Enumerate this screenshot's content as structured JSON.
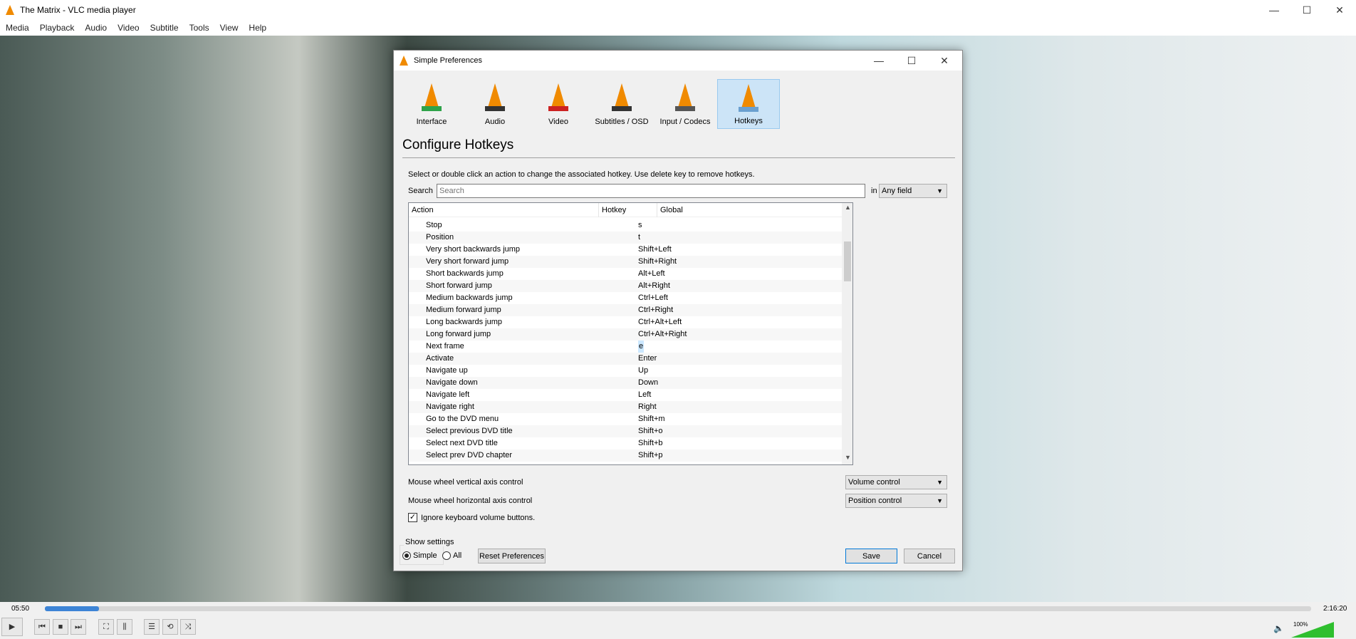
{
  "window": {
    "title": "The Matrix - VLC media player",
    "minimize": "—",
    "maximize": "☐",
    "close": "✕"
  },
  "menu": [
    "Media",
    "Playback",
    "Audio",
    "Video",
    "Subtitle",
    "Tools",
    "View",
    "Help"
  ],
  "dialog": {
    "title": "Simple Preferences",
    "tabs": [
      {
        "label": "Interface",
        "icon": "interface-icon"
      },
      {
        "label": "Audio",
        "icon": "audio-icon"
      },
      {
        "label": "Video",
        "icon": "video-icon"
      },
      {
        "label": "Subtitles / OSD",
        "icon": "subtitles-icon"
      },
      {
        "label": "Input / Codecs",
        "icon": "input-icon"
      },
      {
        "label": "Hotkeys",
        "icon": "hotkeys-icon",
        "selected": true
      }
    ],
    "heading": "Configure Hotkeys",
    "description": "Select or double click an action to change the associated hotkey. Use delete key to remove hotkeys.",
    "search_label": "Search",
    "search_placeholder": "Search",
    "in_label": "in",
    "field_select": "Any field",
    "columns": [
      "Action",
      "Hotkey",
      "Global"
    ],
    "rows": [
      {
        "action": "Stop",
        "hotkey": "s"
      },
      {
        "action": "Position",
        "hotkey": "t"
      },
      {
        "action": "Very short backwards jump",
        "hotkey": "Shift+Left"
      },
      {
        "action": "Very short forward jump",
        "hotkey": "Shift+Right"
      },
      {
        "action": "Short backwards jump",
        "hotkey": "Alt+Left"
      },
      {
        "action": "Short forward jump",
        "hotkey": "Alt+Right"
      },
      {
        "action": "Medium backwards jump",
        "hotkey": "Ctrl+Left"
      },
      {
        "action": "Medium forward jump",
        "hotkey": "Ctrl+Right"
      },
      {
        "action": "Long backwards jump",
        "hotkey": "Ctrl+Alt+Left"
      },
      {
        "action": "Long forward jump",
        "hotkey": "Ctrl+Alt+Right"
      },
      {
        "action": "Next frame",
        "hotkey": "e",
        "selected": true
      },
      {
        "action": "Activate",
        "hotkey": "Enter"
      },
      {
        "action": "Navigate up",
        "hotkey": "Up"
      },
      {
        "action": "Navigate down",
        "hotkey": "Down"
      },
      {
        "action": "Navigate left",
        "hotkey": "Left"
      },
      {
        "action": "Navigate right",
        "hotkey": "Right"
      },
      {
        "action": "Go to the DVD menu",
        "hotkey": "Shift+m"
      },
      {
        "action": "Select previous DVD title",
        "hotkey": "Shift+o"
      },
      {
        "action": "Select next DVD title",
        "hotkey": "Shift+b"
      },
      {
        "action": "Select prev DVD chapter",
        "hotkey": "Shift+p"
      }
    ],
    "wheel_vertical_label": "Mouse wheel vertical axis control",
    "wheel_vertical_value": "Volume control",
    "wheel_horizontal_label": "Mouse wheel horizontal axis control",
    "wheel_horizontal_value": "Position control",
    "ignore_volume_label": "Ignore keyboard volume buttons.",
    "ignore_volume_checked": true,
    "show_settings_label": "Show settings",
    "simple_label": "Simple",
    "all_label": "All",
    "reset_label": "Reset Preferences",
    "save_label": "Save",
    "cancel_label": "Cancel"
  },
  "player": {
    "elapsed": "05:50",
    "total": "2:16:20",
    "progress_percent": 4.3,
    "volume_label": "100%",
    "volume_percent": 100
  }
}
